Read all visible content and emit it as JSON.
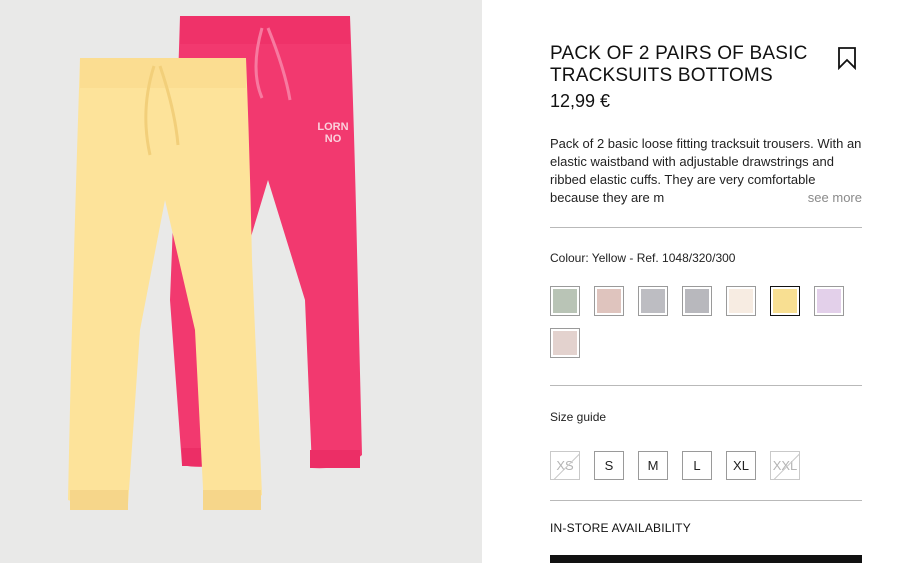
{
  "product": {
    "title": "PACK OF 2 PAIRS OF BASIC TRACKSUITS BOTTOMS",
    "price": "12,99 €",
    "description": "Pack of 2 basic loose fitting tracksuit trousers. With an elastic waistband with adjustable drawstrings and ribbed elastic cuffs. They are very comfortable because they are m",
    "see_more_label": "see more",
    "image_logo_text": "LORN NO"
  },
  "colour": {
    "label": "Colour: Yellow - Ref. 1048/320/300",
    "selected": "Yellow",
    "swatches": [
      {
        "name": "green",
        "color": "#b9c4b6"
      },
      {
        "name": "rose",
        "color": "#dfc4be"
      },
      {
        "name": "grey",
        "color": "#bdbdc2"
      },
      {
        "name": "grey-2",
        "color": "#b8b8bd"
      },
      {
        "name": "cream",
        "color": "#f7ece2"
      },
      {
        "name": "yellow",
        "color": "#f8df92",
        "selected": true
      },
      {
        "name": "lilac",
        "color": "#e3d0ea"
      },
      {
        "name": "blush",
        "color": "#e3d2ce"
      }
    ]
  },
  "sizes": {
    "guide_label": "Size guide",
    "items": [
      {
        "label": "XS",
        "available": false
      },
      {
        "label": "S",
        "available": true
      },
      {
        "label": "M",
        "available": true
      },
      {
        "label": "L",
        "available": true
      },
      {
        "label": "XL",
        "available": true
      },
      {
        "label": "XXL",
        "available": false
      }
    ]
  },
  "availability_label": "IN-STORE AVAILABILITY",
  "colors": {
    "pink_trousers": "#f2396f",
    "yellow_trousers": "#fde39a",
    "background": "#e9e9e8"
  }
}
